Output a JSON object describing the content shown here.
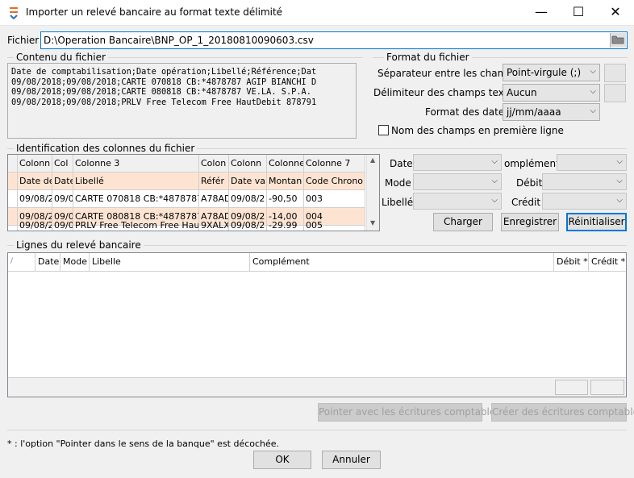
{
  "window": {
    "title": "Importer un relevé bancaire au format texte délimité",
    "minimize": "—",
    "maximize": "☐",
    "close": "✕"
  },
  "file": {
    "label": "Fichier",
    "path": "D:\\Operation Bancaire\\BNP_OP_1_20180810090603.csv"
  },
  "content": {
    "title": "Contenu du fichier",
    "lines": [
      "Date de comptabilisation;Date opération;Libellé;Référence;Dat",
      "09/08/2018;09/08/2018;CARTE 070818 CB:*4878787 AGIP BIANCHI D",
      "09/08/2018;09/08/2018;CARTE 080818 CB:*4878787 VE.LA. S.P.A.",
      "09/08/2018;09/08/2018;PRLV Free Telecom Free HautDebit 878791"
    ]
  },
  "format": {
    "title": "Format du fichier",
    "separator_label": "Séparateur entre les champs",
    "separator_value": "Point-virgule (;)",
    "delimiter_label": "Délimiteur des champs textes",
    "delimiter_value": "Aucun",
    "date_label": "Format des dates",
    "date_value": "jj/mm/aaaa",
    "header_checkbox_label": "Nom des champs en première ligne"
  },
  "columns": {
    "title": "Identification des colonnes du fichier",
    "headers": [
      "Colonn",
      "Col",
      "Colonne 3",
      "Colon",
      "Colonn",
      "Colonne",
      "Colonne 7"
    ],
    "rows": [
      [
        "Date de",
        "Date",
        "Libellé",
        "Référ",
        "Date val",
        "Montan",
        "Code Chrono"
      ],
      [
        "09/08/2",
        "09/0",
        "CARTE 070818 CB:*4878787 A",
        "A78AD",
        "09/08/2",
        "-90,50",
        "003"
      ],
      [
        "09/08/2",
        "09/0",
        "CARTE 080818 CB:*4878787 V",
        "A78AD",
        "09/08/2",
        "-14,00",
        "004"
      ],
      [
        "09/08/2",
        "09/0",
        "PRLV Free Telecom Free Hau",
        "9XALX",
        "09/08/2",
        "-29.99",
        "005"
      ]
    ],
    "field_labels": {
      "date": "Date",
      "mode": "Mode",
      "libelle": "Libellé",
      "complement": "omplément",
      "debit": "Débit",
      "credit": "Crédit"
    },
    "btn_load": "Charger",
    "btn_save": "Enregistrer",
    "btn_reset": "Réinitialiser"
  },
  "statement": {
    "title": "Lignes du relevé bancaire",
    "headers": [
      "",
      "Date",
      "Mode",
      "Libelle",
      "Complément",
      "Débit *",
      "Crédit *"
    ]
  },
  "actions": {
    "point": "Pointer avec les écritures comptables",
    "create": "Créer des écritures comptables"
  },
  "footnote": "* : l'option \"Pointer dans le sens de la banque\" est décochée.",
  "buttons": {
    "ok": "OK",
    "cancel": "Annuler"
  },
  "colors": {
    "accent": "#0078d7",
    "highlight_row": "#fde4d2"
  }
}
